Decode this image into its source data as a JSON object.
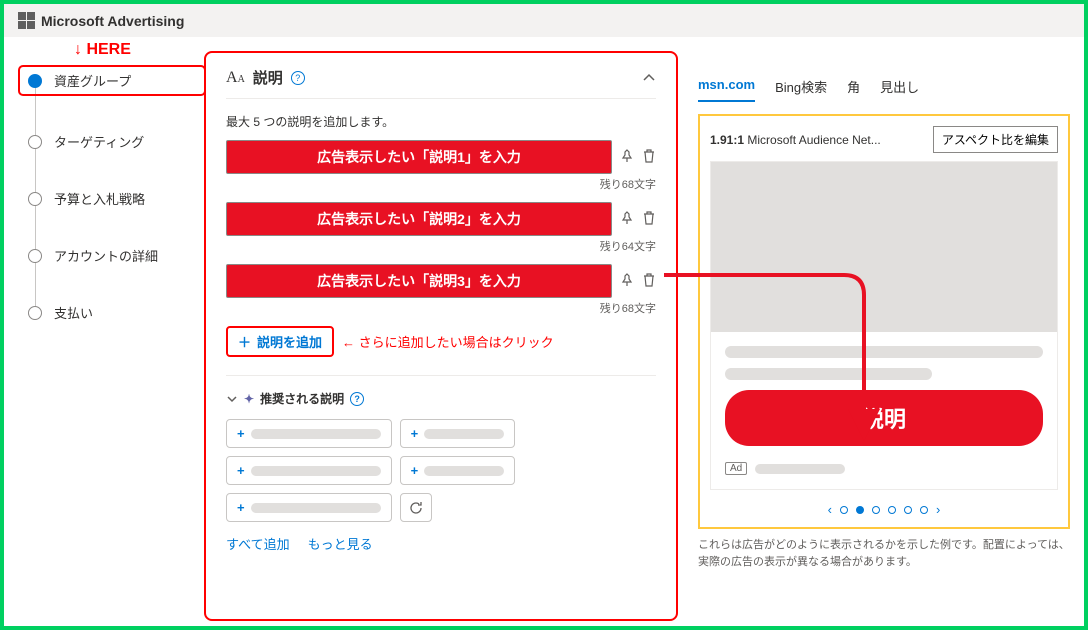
{
  "header": {
    "brand": "Microsoft Advertising"
  },
  "annotations": {
    "here": "↓ HERE",
    "add_note": "← さらに追加したい場合はクリック"
  },
  "sidebar": {
    "items": [
      {
        "label": "資産グループ",
        "active": true
      },
      {
        "label": "ターゲティング",
        "active": false
      },
      {
        "label": "予算と入札戦略",
        "active": false
      },
      {
        "label": "アカウントの詳細",
        "active": false
      },
      {
        "label": "支払い",
        "active": false
      }
    ]
  },
  "panel": {
    "title": "説明",
    "subtitle": "最大 5 つの説明を追加します。",
    "descriptions": [
      {
        "text": "広告表示したい「説明1」を入力",
        "counter": "残り68文字"
      },
      {
        "text": "広告表示したい「説明2」を入力",
        "counter": "残り64文字"
      },
      {
        "text": "広告表示したい「説明3」を入力",
        "counter": "残り68文字"
      }
    ],
    "add_label": "説明を追加",
    "recommend_title": "推奨される説明",
    "links": {
      "add_all": "すべて追加",
      "more": "もっと見る"
    }
  },
  "preview": {
    "tabs": [
      "msn.com",
      "Bing検索",
      "角",
      "見出し"
    ],
    "active_tab": 0,
    "ratio_label": "1.91:1",
    "network": "Microsoft Audience Net...",
    "edit_aspect": "アスペクト比を編集",
    "desc_pill": "説明",
    "ad_badge": "Ad",
    "pager_count": 6,
    "pager_active": 1,
    "disclaimer": "これらは広告がどのように表示されるかを示した例です。配置によっては、実際の広告の表示が異なる場合があります。"
  }
}
